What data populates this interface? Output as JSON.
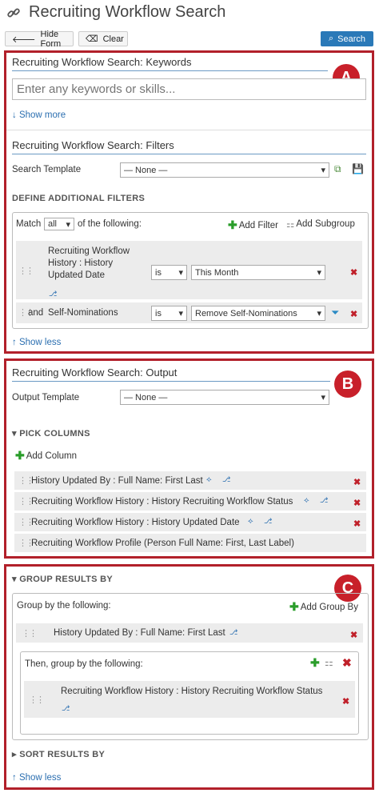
{
  "header": {
    "title": "Recruiting Workflow Search"
  },
  "toolbar": {
    "hide_form": "Hide Form",
    "clear": "Clear",
    "search": "Search"
  },
  "keywords": {
    "title": "Recruiting Workflow Search: Keywords",
    "placeholder": "Enter any keywords or skills...",
    "show_more": "Show more"
  },
  "filters": {
    "title": "Recruiting Workflow Search: Filters",
    "template_label": "Search Template",
    "template_value": "— None —",
    "define_heading": "DEFINE ADDITIONAL FILTERS",
    "match_label": "Match",
    "match_value": "all",
    "match_suffix": "of the following:",
    "add_filter": "Add Filter",
    "add_subgroup": "Add Subgroup",
    "rows": [
      {
        "conj": "",
        "field": "Recruiting Workflow History : History Updated Date",
        "op": "is",
        "value": "This Month"
      },
      {
        "conj": "and",
        "field": "Self-Nominations",
        "op": "is",
        "value": "Remove Self-Nominations"
      }
    ],
    "show_less": "Show less"
  },
  "output": {
    "title": "Recruiting Workflow Search: Output",
    "template_label": "Output Template",
    "template_value": "— None —",
    "pick_columns": "PICK COLUMNS",
    "add_column": "Add Column",
    "columns": [
      "History Updated By : Full Name: First Last",
      "Recruiting Workflow History : History Recruiting Workflow Status",
      "Recruiting Workflow History : History Updated Date",
      "Recruiting Workflow Profile (Person Full Name: First, Last Label)"
    ]
  },
  "group": {
    "heading": "GROUP RESULTS BY",
    "group_label": "Group by the following:",
    "add_group": "Add Group By",
    "group_row": "History Updated By : Full Name: First Last",
    "then_label": "Then, group by the following:",
    "then_row": "Recruiting Workflow History : History Recruiting Workflow Status",
    "sort_heading": "SORT RESULTS BY",
    "show_less": "Show less"
  },
  "badges": {
    "a": "A",
    "b": "B",
    "c": "C"
  }
}
